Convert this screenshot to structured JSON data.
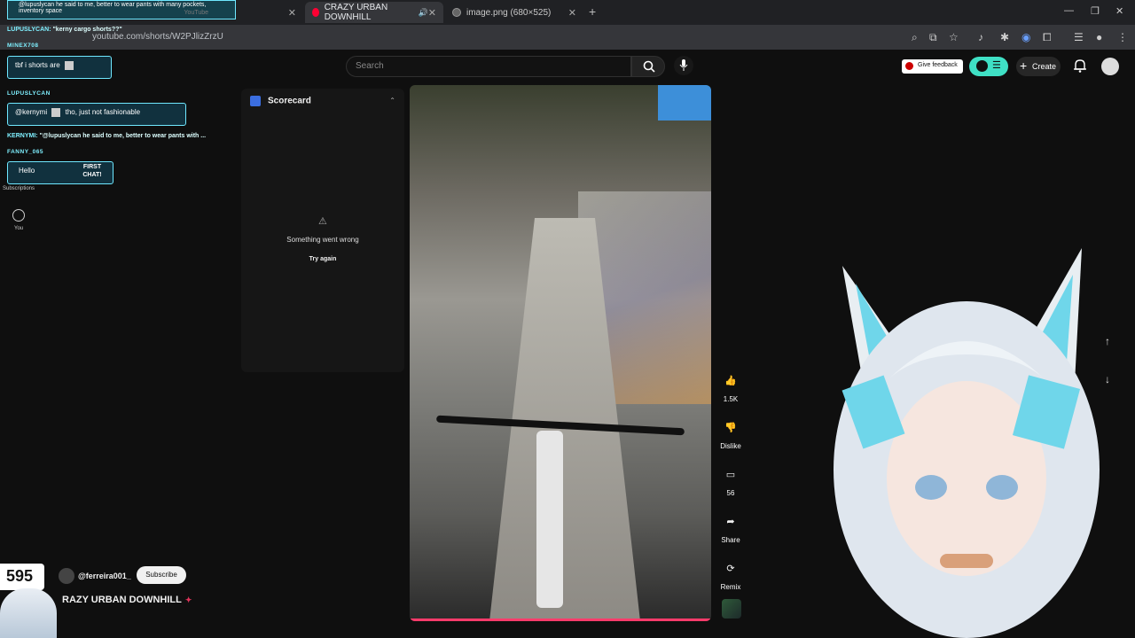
{
  "browser": {
    "tabs": [
      {
        "label": "",
        "active": false
      },
      {
        "label": "CRAZY URBAN DOWNHILL",
        "active": true
      },
      {
        "label": "image.png (680×525)",
        "active": false
      }
    ],
    "url": "youtube.com/shorts/W2PJlizZrzU"
  },
  "youtube": {
    "search_placeholder": "Search",
    "feedback_label": "Give feedback",
    "create_label": "Create"
  },
  "sidebar": {
    "subscriptions_label": "Subscriptions",
    "you_label": "You"
  },
  "scorecard": {
    "title": "Scorecard",
    "error": "Something went wrong",
    "retry": "Try again"
  },
  "actions": {
    "likes": "1.5K",
    "dislike": "Dislike",
    "comments": "56",
    "share": "Share",
    "remix": "Remix"
  },
  "video": {
    "channel": "@ferreira001_",
    "subscribe": "Subscribe",
    "title": "RAZY URBAN DOWNHILL"
  },
  "chat": {
    "header_text": "@lupuslycan he said to me, better to wear pants with many pockets, inventory space",
    "header_youtube": "YouTube",
    "line1_user": "LUPUSLYCAN:",
    "line1_text": "\"kerny cargo shorts??\"",
    "user_minex": "MINEX708",
    "msg_minex": "tbf i shorts are",
    "user_lupus": "LUPUSLYCAN",
    "msg_lupus": "@kernymi",
    "msg_lupus_rest": "tho, just not fashionable",
    "line2_user": "KERNYMI:",
    "line2_text": "\"@lupuslycan he said to me, better to wear pants with ...",
    "user_fanny": "FANNY_065",
    "msg_fanny": "Hello",
    "first_chat": "FIRST CHAT!"
  },
  "overlay": {
    "viewer_count": "595"
  },
  "colors": {
    "accent": "#3fe0c5",
    "chat_border": "#6fe8ff",
    "progress": "#ff3b6b"
  }
}
